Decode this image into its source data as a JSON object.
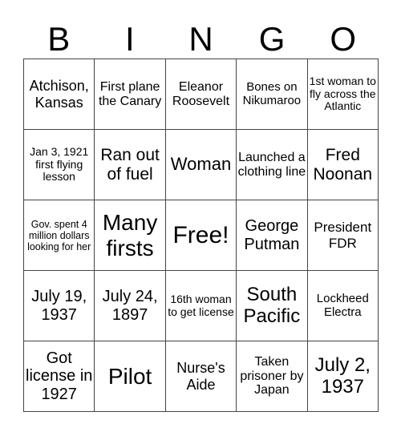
{
  "header": {
    "letters": [
      "B",
      "I",
      "N",
      "G",
      "O"
    ]
  },
  "cells": [
    [
      "Atchison, Kansas",
      "First plane the Canary",
      "Eleanor Roosevelt",
      "Bones on Nikumaroo",
      "1st woman to fly across the Atlantic"
    ],
    [
      "Jan 3, 1921 first flying lesson",
      "Ran out of fuel",
      "Woman",
      "Launched a clothing line",
      "Fred Noonan"
    ],
    [
      "Gov. spent 4 million dollars looking for her",
      "Many firsts",
      "Free!",
      "George Putman",
      "President FDR"
    ],
    [
      "July 19, 1937",
      "July 24, 1897",
      "16th woman to get license",
      "South Pacific",
      "Lockheed Electra"
    ],
    [
      "Got license in 1927",
      "Pilot",
      "Nurse's Aide",
      "Taken prisoner by Japan",
      "July 2, 1937"
    ]
  ]
}
